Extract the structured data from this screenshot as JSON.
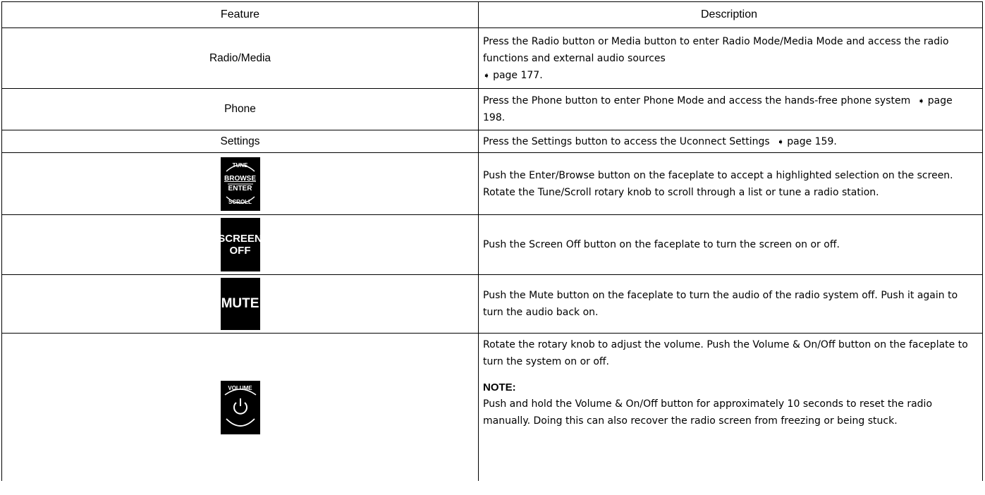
{
  "header": {
    "feature": "Feature",
    "description": "Description"
  },
  "rows": [
    {
      "feature": "Radio/Media",
      "desc": "Press the Radio button or Media button to enter Radio Mode/Media Mode and access the radio functions and external audio sources",
      "page": "page 177."
    },
    {
      "feature": "Phone",
      "desc": "Press the Phone button to enter Phone Mode and access the hands-free phone system",
      "page": "page 198."
    },
    {
      "feature": "Settings",
      "desc": "Press the Settings button to access the Uconnect Settings",
      "page": "page 159."
    },
    {
      "icon": "browse-enter-knob-icon",
      "icon_text": {
        "top": "TUNE",
        "mid1": "BROWSE",
        "mid2": "ENTER",
        "bottom": "SCROLL"
      },
      "desc": "Push the Enter/Browse button on the faceplate to accept a highlighted selection on the screen. Rotate the Tune/Scroll rotary knob to scroll through a list or tune a radio station."
    },
    {
      "icon": "screen-off-button-icon",
      "icon_text": {
        "line1": "SCREEN",
        "line2": "OFF"
      },
      "desc": "Push the Screen Off button on the faceplate to turn the screen on or off."
    },
    {
      "icon": "mute-button-icon",
      "icon_text": {
        "line1": "MUTE"
      },
      "desc": "Push the Mute button on the faceplate to turn the audio of the radio system off. Push it again to turn the audio back on."
    },
    {
      "icon": "volume-power-knob-icon",
      "icon_text": {
        "top": "VOLUME"
      },
      "desc": "Rotate the rotary knob to adjust the volume. Push the Volume & On/Off button on the faceplate to turn the system on or off.",
      "note_heading": "NOTE:",
      "note": "Push and hold the Volume & On/Off button for approximately 10 seconds to reset the radio manually. Doing this can also recover the radio screen from freezing or being stuck."
    }
  ],
  "xref_icon": "arrow-right-icon"
}
